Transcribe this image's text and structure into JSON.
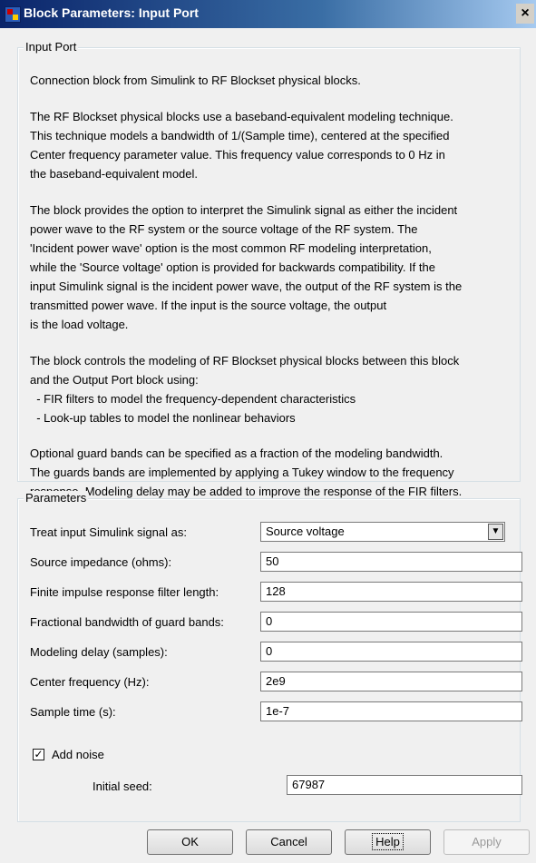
{
  "window": {
    "title": "Block Parameters: Input Port",
    "close_glyph": "×",
    "icon": "simulink-block-icon"
  },
  "input_port_group": {
    "legend": "Input Port",
    "paragraphs": [
      "Connection block from Simulink to RF Blockset physical blocks.",
      "The RF Blockset physical blocks use a baseband-equivalent modeling technique.",
      "This technique models a bandwidth of 1/(Sample time), centered at the specified",
      "Center frequency parameter value. This frequency value corresponds to 0 Hz in",
      "the baseband-equivalent model.",
      "The block provides the option to interpret the Simulink signal as either the incident",
      "power wave to the RF system or the source voltage of the RF system. The",
      "'Incident power wave' option is the most common RF modeling interpretation,",
      "while the 'Source voltage' option is provided for backwards compatibility. If the",
      "input Simulink signal is the incident power wave, the output of the RF system is the",
      "transmitted power wave. If the input is the source voltage, the output",
      "is the load voltage.",
      "The block controls the modeling of RF Blockset physical blocks between this block",
      "and the Output Port block using:",
      "  - FIR filters to model the frequency-dependent characteristics",
      "  - Look-up tables to model the nonlinear behaviors",
      "Optional guard bands can be specified as a fraction of the modeling bandwidth.",
      "The guards bands are implemented by applying a Tukey window to the frequency",
      "response. Modeling delay may be added to improve the response of the FIR filters."
    ]
  },
  "parameters_group": {
    "legend": "Parameters",
    "treat_input_label": "Treat input Simulink signal as:",
    "treat_input_value": "Source voltage",
    "source_impedance_label": "Source impedance (ohms):",
    "source_impedance_value": "50",
    "fir_length_label": "Finite impulse response filter length:",
    "fir_length_value": "128",
    "guard_bands_label": "Fractional bandwidth of guard bands:",
    "guard_bands_value": "0",
    "modeling_delay_label": "Modeling delay (samples):",
    "modeling_delay_value": "0",
    "center_freq_label": "Center frequency (Hz):",
    "center_freq_value": "2e9",
    "sample_time_label": "Sample time (s):",
    "sample_time_value": "1e-7",
    "add_noise_label": "Add noise",
    "add_noise_checked": true,
    "checkmark_glyph": "✓",
    "initial_seed_label": "Initial seed:",
    "initial_seed_value": "67987"
  },
  "buttons": {
    "ok": "OK",
    "cancel": "Cancel",
    "help": "Help",
    "apply": "Apply"
  },
  "colors": {
    "titlebar_start": "#0a246a",
    "titlebar_end": "#a6caf0",
    "background": "#f0f0f0"
  }
}
